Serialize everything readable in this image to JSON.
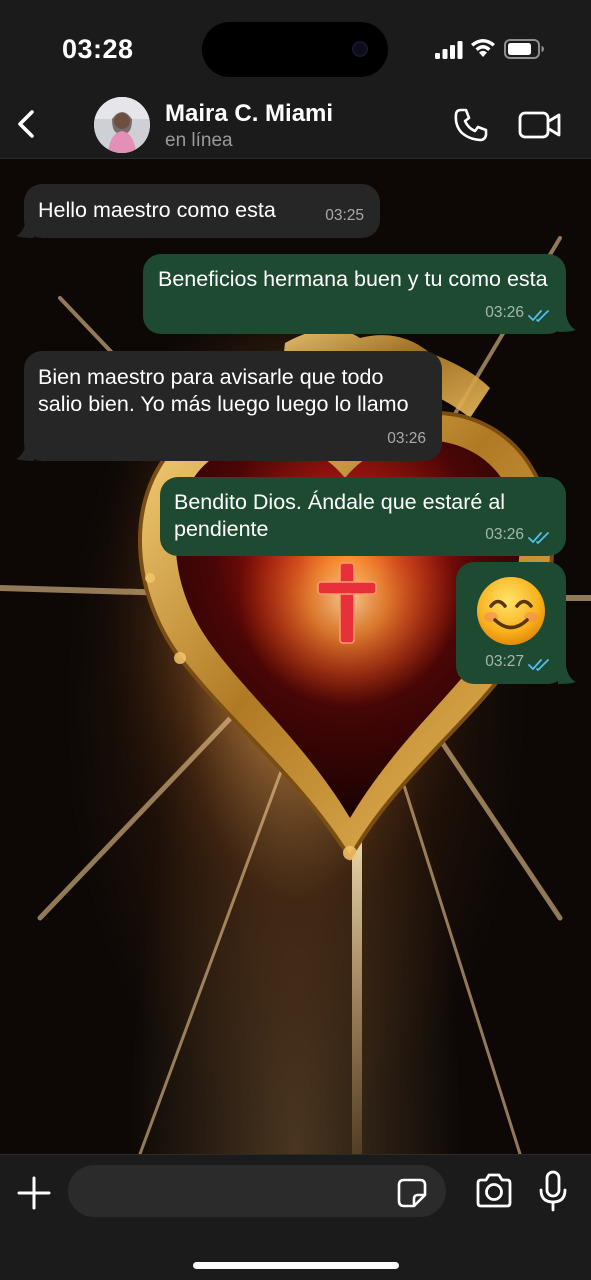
{
  "status_bar": {
    "time": "03:28",
    "icons": [
      "signal-icon",
      "wifi-icon",
      "battery-icon"
    ]
  },
  "header": {
    "contact_name": "Maira C. Miami",
    "contact_status": "en línea",
    "icons": [
      "back-chevron-icon",
      "phone-icon",
      "video-camera-icon"
    ]
  },
  "messages": [
    {
      "direction": "incoming",
      "text": "Hello maestro como esta",
      "time": "03:25"
    },
    {
      "direction": "outgoing",
      "text": "Beneficios hermana buen y tu como esta",
      "time": "03:26",
      "status": "read"
    },
    {
      "direction": "incoming",
      "text": "Bien maestro para avisarle que todo salio bien. Yo más luego luego lo llamo",
      "time": "03:26"
    },
    {
      "direction": "outgoing",
      "text": "Bendito Dios. Ándale que estaré al pendiente",
      "time": "03:26",
      "status": "read"
    },
    {
      "direction": "outgoing",
      "emoji": "smiling-face-with-smiling-eyes",
      "time": "03:27",
      "status": "read"
    }
  ],
  "input_bar": {
    "placeholder": "",
    "icons": [
      "plus-icon",
      "sticker-icon",
      "camera-icon",
      "microphone-icon"
    ]
  },
  "colors": {
    "bar_background": "#1b1b1b",
    "incoming_bubble": "#262626",
    "outgoing_bubble": "#1d4a30",
    "read_ticks": "#53bdeb",
    "muted_text": "#9a9a9a"
  }
}
